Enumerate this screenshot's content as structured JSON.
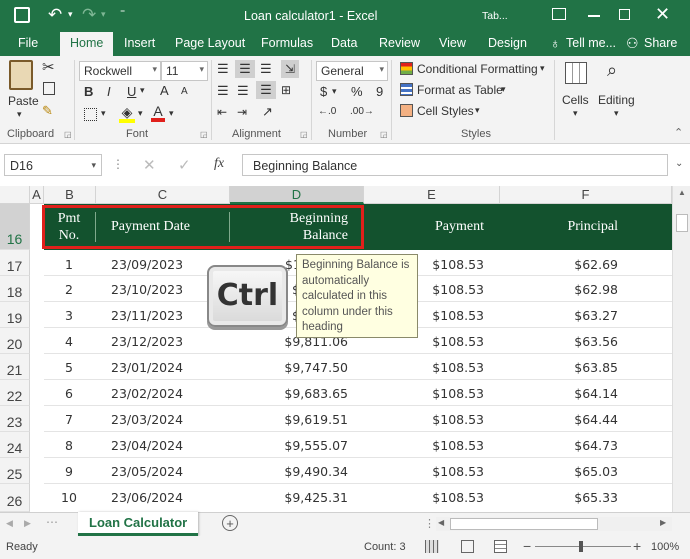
{
  "app": {
    "title": "Loan calculator1 - Excel",
    "table_tools_tab": "Tab..."
  },
  "tabs": [
    "File",
    "Home",
    "Insert",
    "Page Layout",
    "Formulas",
    "Data",
    "Review",
    "View",
    "Design"
  ],
  "tell_me": "Tell me...",
  "share": "Share",
  "ribbon": {
    "paste": "Paste",
    "font_name": "Rockwell",
    "font_size": "11",
    "number_format": "General",
    "conditional_formatting": "Conditional Formatting",
    "format_as_table": "Format as Table",
    "cell_styles": "Cell Styles",
    "cells": "Cells",
    "editing": "Editing",
    "groups": {
      "clipboard": "Clipboard",
      "font": "Font",
      "alignment": "Alignment",
      "number": "Number",
      "styles": "Styles"
    },
    "font_buttons": {
      "bold": "B",
      "italic": "I",
      "underline": "U"
    },
    "number_buttons": {
      "currency": "$",
      "percent": "%",
      "comma": "9"
    }
  },
  "formula_bar": {
    "name_box": "D16",
    "fx": "fx",
    "content": "Beginning Balance"
  },
  "columns": [
    "A",
    "B",
    "C",
    "D",
    "E",
    "F"
  ],
  "rows": [
    "16",
    "17",
    "18",
    "19",
    "20",
    "21",
    "22",
    "23",
    "24",
    "25",
    "26"
  ],
  "table": {
    "headers": {
      "pmt_line1": "Pmt",
      "pmt_line2": "No.",
      "date": "Payment Date",
      "bal_line1": "Beginning",
      "bal_line2": "Balance",
      "payment": "Payment",
      "principal": "Principal"
    },
    "rows": [
      {
        "no": "1",
        "date": "23/09/2023",
        "balance": "$1",
        "payment": "$108.53",
        "principal": "$62.69"
      },
      {
        "no": "2",
        "date": "23/10/2023",
        "balance": "$",
        "payment": "$108.53",
        "principal": "$62.98"
      },
      {
        "no": "3",
        "date": "23/11/2023",
        "balance": "$",
        "payment": "$108.53",
        "principal": "$63.27"
      },
      {
        "no": "4",
        "date": "23/12/2023",
        "balance": "$9,811.06",
        "payment": "$108.53",
        "principal": "$63.56"
      },
      {
        "no": "5",
        "date": "23/01/2024",
        "balance": "$9,747.50",
        "payment": "$108.53",
        "principal": "$63.85"
      },
      {
        "no": "6",
        "date": "23/02/2024",
        "balance": "$9,683.65",
        "payment": "$108.53",
        "principal": "$64.14"
      },
      {
        "no": "7",
        "date": "23/03/2024",
        "balance": "$9,619.51",
        "payment": "$108.53",
        "principal": "$64.44"
      },
      {
        "no": "8",
        "date": "23/04/2024",
        "balance": "$9,555.07",
        "payment": "$108.53",
        "principal": "$64.73"
      },
      {
        "no": "9",
        "date": "23/05/2024",
        "balance": "$9,490.34",
        "payment": "$108.53",
        "principal": "$65.03"
      },
      {
        "no": "10",
        "date": "23/06/2024",
        "balance": "$9,425.31",
        "payment": "$108.53",
        "principal": "$65.33"
      }
    ]
  },
  "tooltip": "Beginning Balance is automatically calculated in this column under this heading",
  "key_overlay": "Ctrl",
  "sheet_tab": "Loan Calculator",
  "status": {
    "ready": "Ready",
    "count": "Count: 3",
    "zoom": "100%"
  },
  "colors": {
    "excel_green": "#217346",
    "header_fill": "#13522e",
    "highlight_red": "#e0201b"
  }
}
